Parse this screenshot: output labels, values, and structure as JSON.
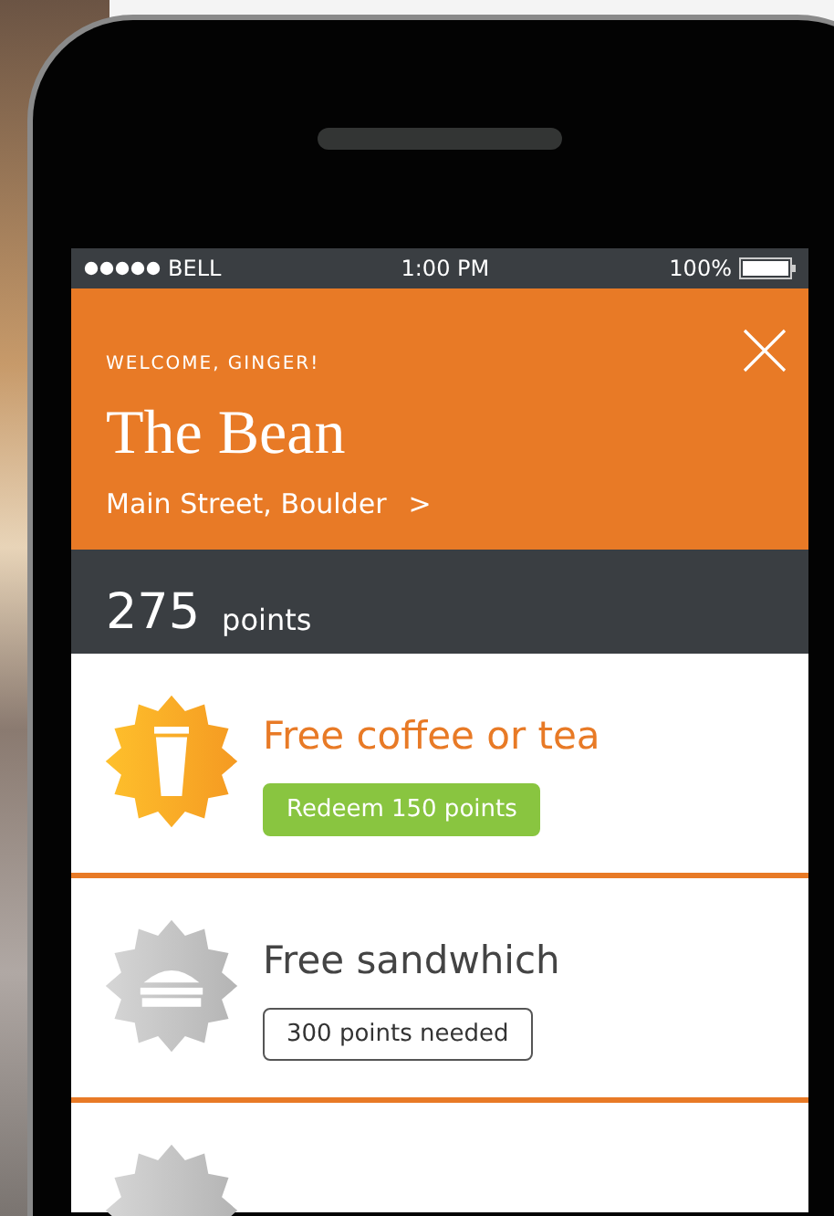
{
  "status_bar": {
    "carrier": "BELL",
    "time": "1:00 PM",
    "battery": "100%"
  },
  "header": {
    "greeting": "WELCOME, GINGER!",
    "title": "The Bean",
    "location": "Main Street, Boulder",
    "chevron": ">"
  },
  "points": {
    "value": "275",
    "unit": "points"
  },
  "rewards": [
    {
      "kind": "redeemable",
      "title": "Free coffee or tea",
      "action": "Redeem 150 points"
    },
    {
      "kind": "locked",
      "title": "Free sandwhich",
      "action": "300 points needed"
    }
  ]
}
